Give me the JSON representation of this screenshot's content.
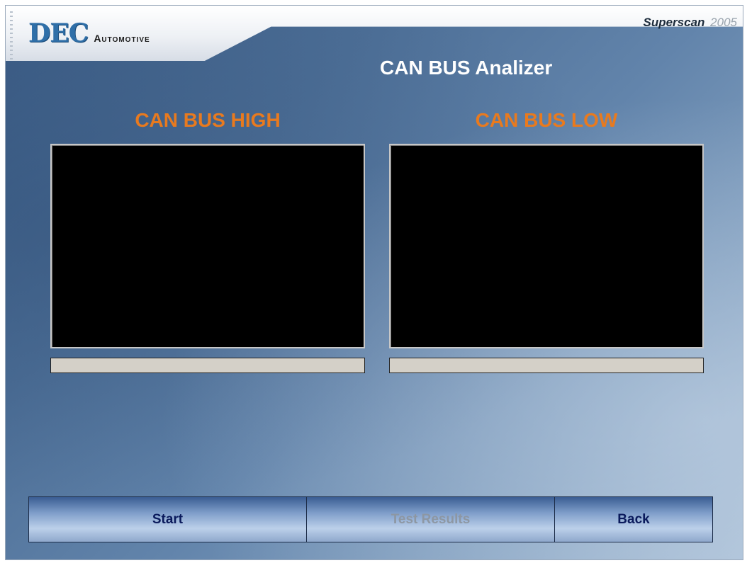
{
  "header": {
    "logo_main": "DEC",
    "logo_sub": "Automotive",
    "product_name": "Superscan",
    "product_year": "2005"
  },
  "page": {
    "title": "CAN BUS Analizer"
  },
  "panels": [
    {
      "title": "CAN BUS HIGH",
      "status": ""
    },
    {
      "title": "CAN BUS LOW",
      "status": ""
    }
  ],
  "buttons": {
    "start": "Start",
    "test_results": "Test Results",
    "back": "Back"
  },
  "colors": {
    "panel_title": "#e87a1f",
    "page_title": "#ffffff",
    "button_text": "#0a1a5c",
    "button_text_disabled": "#8d97a3",
    "scope_background": "#000000",
    "status_bar": "#d4d0c8"
  }
}
